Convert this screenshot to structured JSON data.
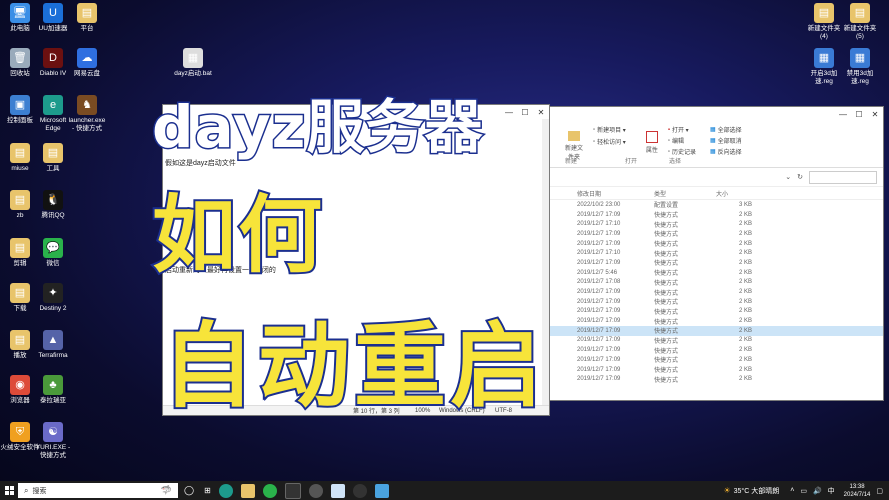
{
  "desktop_left": [
    {
      "label": "此电脑",
      "color": "#3a8ee6",
      "glyph": "🖥"
    },
    {
      "label": "UU加速器",
      "color": "#1b6fd8",
      "glyph": "U"
    },
    {
      "label": "平台",
      "color": "#e8c46b",
      "glyph": "▤"
    },
    {
      "label": "回收站",
      "color": "#9ab",
      "glyph": "🗑"
    },
    {
      "label": "Diablo IV",
      "color": "#6b1010",
      "glyph": "D"
    },
    {
      "label": "网易云盘",
      "color": "#2f6fe0",
      "glyph": "☁"
    },
    {
      "label": "dayz启动.bat",
      "color": "#ddd",
      "glyph": "▦"
    },
    {
      "label": "控制面板",
      "color": "#3c7fd1",
      "glyph": "▣"
    },
    {
      "label": "Microsoft Edge",
      "color": "#1d9b8c",
      "glyph": "e"
    },
    {
      "label": "launcher.exe - 快捷方式",
      "color": "#7a4b22",
      "glyph": "♞"
    },
    {
      "label": "miuse",
      "color": "#e8c46b",
      "glyph": "▤"
    },
    {
      "label": "工具",
      "color": "#e8c46b",
      "glyph": "▤"
    },
    {
      "label": "zb",
      "color": "#e8c46b",
      "glyph": "▤"
    },
    {
      "label": "腾讯QQ",
      "color": "#111",
      "glyph": "🐧"
    },
    {
      "label": "剪辑",
      "color": "#e8c46b",
      "glyph": "▤"
    },
    {
      "label": "微信",
      "color": "#2ab24b",
      "glyph": "💬"
    },
    {
      "label": "下载",
      "color": "#e8c46b",
      "glyph": "▤"
    },
    {
      "label": "Destiny 2",
      "color": "#222",
      "glyph": "✦"
    },
    {
      "label": "播放",
      "color": "#e8c46b",
      "glyph": "▤"
    },
    {
      "label": "Terrafirma",
      "color": "#5563a8",
      "glyph": "▲"
    },
    {
      "label": "浏览器",
      "color": "#dd4b39",
      "glyph": "◉"
    },
    {
      "label": "泰拉瑞亚",
      "color": "#4a9a3a",
      "glyph": "♣"
    },
    {
      "label": "火绒安全软件",
      "color": "#f0a020",
      "glyph": "⛨"
    },
    {
      "label": "YURI.EXE - 快捷方式",
      "color": "#6a6ac8",
      "glyph": "☯"
    }
  ],
  "desktop_right": [
    {
      "label": "新建文件夹 (4)",
      "color": "#e8c46b",
      "glyph": "▤"
    },
    {
      "label": "新建文件夹 (5)",
      "color": "#e8c46b",
      "glyph": "▤"
    },
    {
      "label": "开启3d加速.reg",
      "color": "#3a7bd5",
      "glyph": "▦"
    },
    {
      "label": "禁用3d加速.reg",
      "color": "#3a7bd5",
      "glyph": "▦"
    }
  ],
  "notepad": {
    "line1": "假如这是dayz启动文件",
    "line2": "启动重新的（最好再设置一...关闭的",
    "status_pos": "第 10 行，第 3 列",
    "status_zoom": "100%",
    "status_eol": "Windows (CRLF)",
    "status_enc": "UTF-8"
  },
  "explorer": {
    "ribbon": {
      "new_item": "新建项目 ▾",
      "easy_access": "轻松访问 ▾",
      "new_folder": "新建文件夹",
      "open": "打开 ▾",
      "edit": "编辑",
      "history": "历史记录",
      "properties": "属性",
      "select_all": "全部选择",
      "select_none": "全部取消",
      "invert": "反向选择",
      "group_new": "新建",
      "group_open": "打开",
      "group_select": "选择"
    },
    "columns": {
      "date": "修改日期",
      "type": "类型",
      "size": "大小"
    },
    "rows": [
      {
        "date": "2022/10/2 23:00",
        "type": "配置设置",
        "size": "3 KB"
      },
      {
        "date": "2019/12/7 17:09",
        "type": "快捷方式",
        "size": "2 KB"
      },
      {
        "date": "2019/12/7 17:10",
        "type": "快捷方式",
        "size": "2 KB"
      },
      {
        "date": "2019/12/7 17:09",
        "type": "快捷方式",
        "size": "2 KB"
      },
      {
        "date": "2019/12/7 17:09",
        "type": "快捷方式",
        "size": "2 KB"
      },
      {
        "date": "2019/12/7 17:10",
        "type": "快捷方式",
        "size": "2 KB"
      },
      {
        "date": "2019/12/7 17:09",
        "type": "快捷方式",
        "size": "2 KB"
      },
      {
        "date": "2019/12/7 5:46",
        "type": "快捷方式",
        "size": "2 KB"
      },
      {
        "date": "2019/12/7 17:08",
        "type": "快捷方式",
        "size": "2 KB"
      },
      {
        "date": "2019/12/7 17:09",
        "type": "快捷方式",
        "size": "2 KB"
      },
      {
        "date": "2019/12/7 17:09",
        "type": "快捷方式",
        "size": "2 KB"
      },
      {
        "date": "2019/12/7 17:09",
        "type": "快捷方式",
        "size": "2 KB"
      },
      {
        "date": "2019/12/7 17:09",
        "type": "快捷方式",
        "size": "2 KB"
      },
      {
        "date": "2019/12/7 17:09",
        "type": "快捷方式",
        "size": "2 KB"
      },
      {
        "date": "2019/12/7 17:09",
        "type": "快捷方式",
        "size": "2 KB"
      },
      {
        "date": "2019/12/7 17:09",
        "type": "快捷方式",
        "size": "2 KB"
      },
      {
        "date": "2019/12/7 17:09",
        "type": "快捷方式",
        "size": "2 KB"
      },
      {
        "date": "2019/12/7 17:09",
        "type": "快捷方式",
        "size": "2 KB"
      },
      {
        "date": "2019/12/7 17:09",
        "type": "快捷方式",
        "size": "2 KB"
      }
    ]
  },
  "overlay": {
    "line1": "dayz服务器",
    "line2": "如何",
    "line3": "自动重启"
  },
  "taskbar": {
    "search": "搜索",
    "weather": "35°C 大部晴朗",
    "time": "13:38",
    "date": "2024/7/14"
  },
  "colors": {
    "overlay_fill": "#f7e43a",
    "overlay_white": "#ffffff",
    "overlay_stroke": "#1b2f8f",
    "accent": "#0078d4"
  }
}
